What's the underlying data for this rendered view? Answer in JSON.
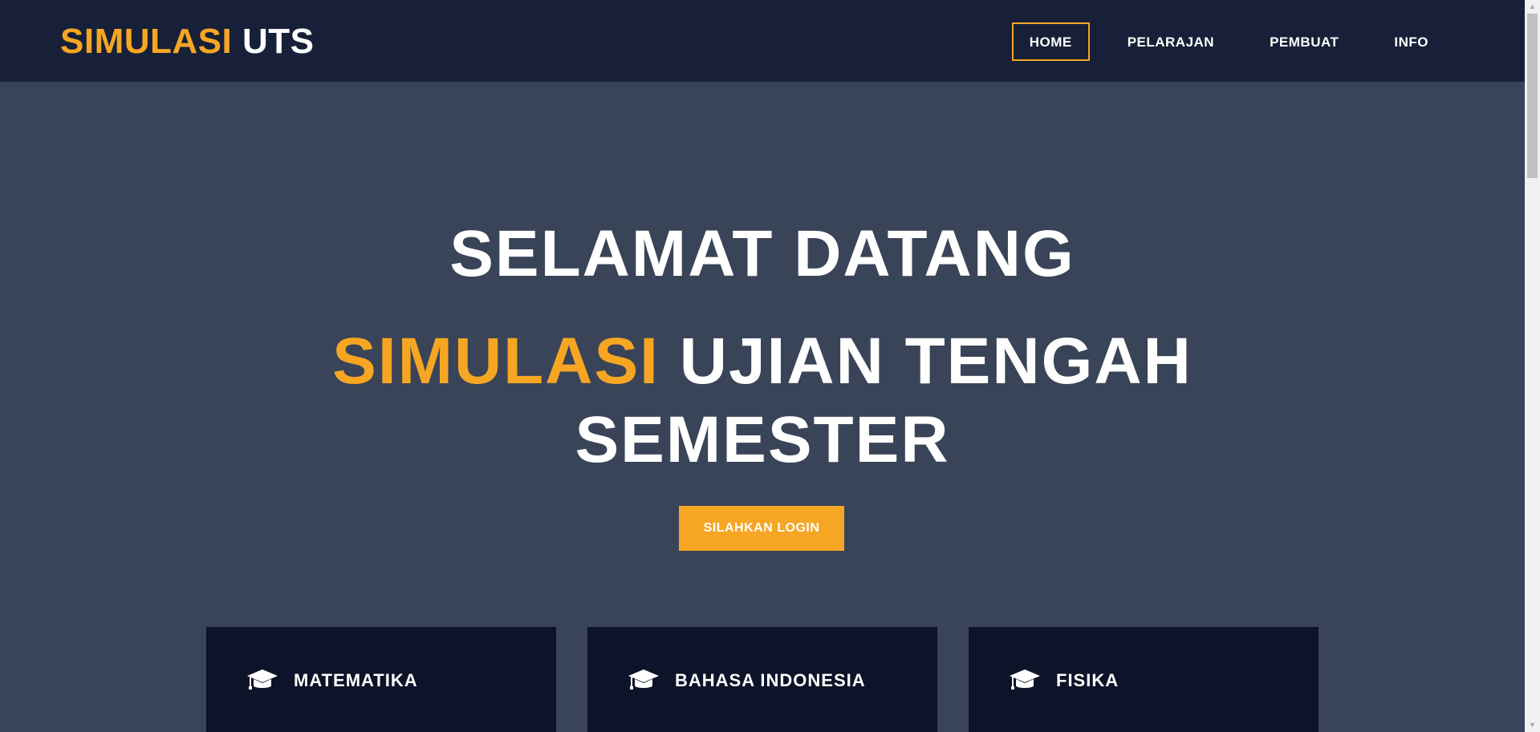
{
  "navbar": {
    "brand_accent": "SIMULASI",
    "brand_rest": "UTS",
    "items": [
      {
        "label": "HOME",
        "active": true
      },
      {
        "label": "PELARAJAN",
        "active": false
      },
      {
        "label": "PEMBUAT",
        "active": false
      },
      {
        "label": "INFO",
        "active": false
      }
    ]
  },
  "hero": {
    "welcome": "SELAMAT DATANG",
    "title_accent": "SIMULASI",
    "title_line1_rest": "UJIAN TENGAH",
    "title_line2": "SEMESTER",
    "login_button": "SILAHKAN LOGIN"
  },
  "cards": [
    {
      "label": "MATEMATIKA",
      "icon": "graduation-cap-icon"
    },
    {
      "label": "BAHASA INDONESIA",
      "icon": "graduation-cap-icon"
    },
    {
      "label": "FISIKA",
      "icon": "graduation-cap-icon"
    }
  ],
  "colors": {
    "accent": "#f6a623",
    "navbar_bg": "#172038",
    "hero_bg": "#3a4458",
    "card_bg": "#0d1328",
    "text": "#ffffff"
  }
}
